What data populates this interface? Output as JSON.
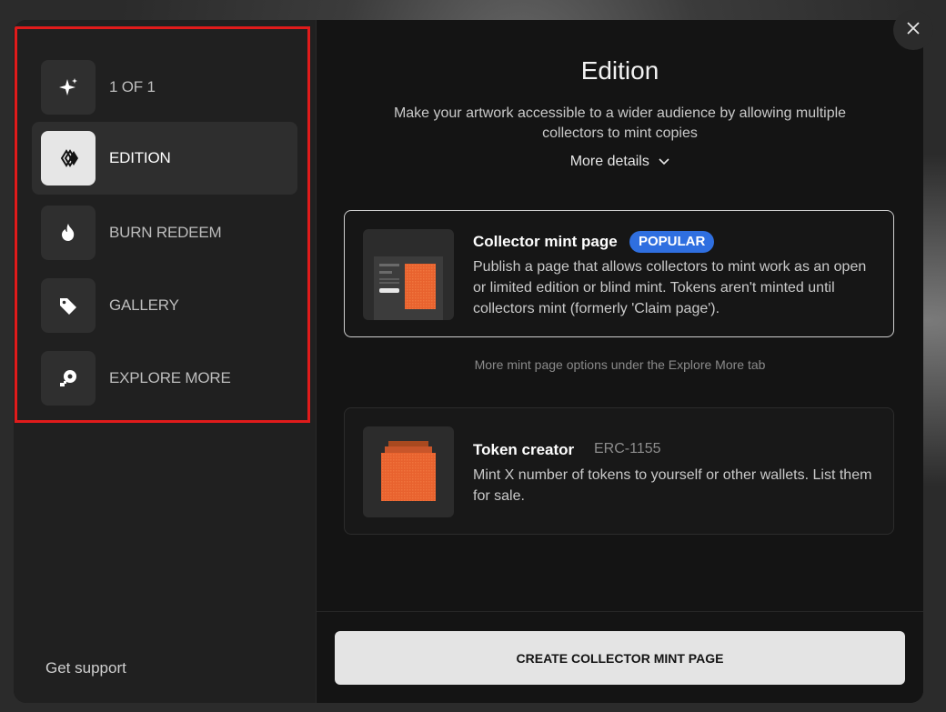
{
  "sidebar": {
    "items": [
      {
        "label": "1 OF 1",
        "icon": "sparkle-icon"
      },
      {
        "label": "EDITION",
        "icon": "edition-icon",
        "active": true
      },
      {
        "label": "BURN REDEEM",
        "icon": "flame-icon"
      },
      {
        "label": "GALLERY",
        "icon": "tag-icon"
      },
      {
        "label": "EXPLORE MORE",
        "icon": "explore-icon"
      }
    ],
    "support_label": "Get support"
  },
  "main": {
    "title": "Edition",
    "subtitle": "Make your artwork accessible to a wider audience by allowing multiple collectors to mint copies",
    "more_details_label": "More details",
    "cards": [
      {
        "title": "Collector mint page",
        "badge": "POPULAR",
        "description": "Publish a page that allows collectors to mint work as an open or limited edition or blind mint. Tokens aren't minted until collectors mint (formerly 'Claim page')."
      },
      {
        "title": "Token creator",
        "tag": "ERC-1155",
        "description": "Mint X number of tokens to yourself or other wallets. List them for sale."
      }
    ],
    "hint": "More mint page options under the Explore More tab",
    "cta_label": "CREATE COLLECTOR MINT PAGE"
  },
  "colors": {
    "accent_badge": "#2f6fe0",
    "thumbnail_orange": "#e8622e",
    "highlight_border": "#e01b1b"
  },
  "close_icon": "close-icon"
}
